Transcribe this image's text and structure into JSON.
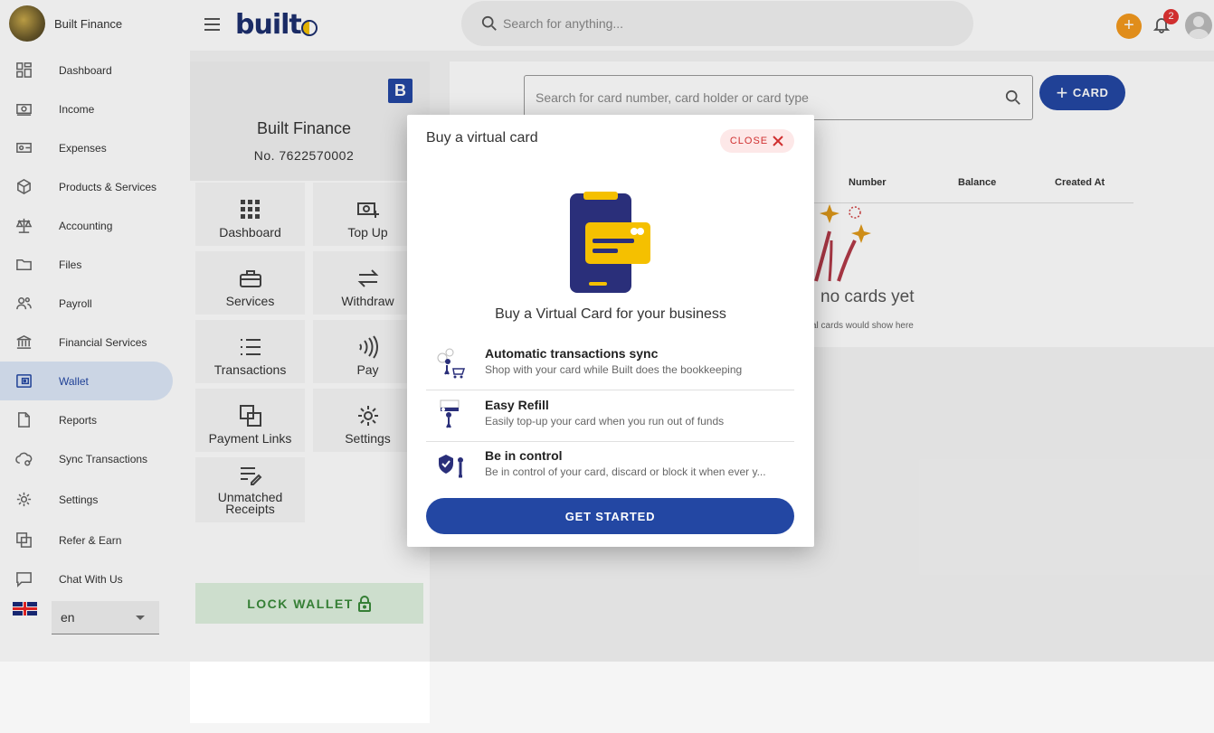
{
  "brand": {
    "name": "Built Finance"
  },
  "topbar": {
    "logo_text": "built",
    "search_placeholder": "Search for anything...",
    "add_label": "+",
    "notification_count": "2"
  },
  "sidebar": {
    "items": [
      {
        "label": "Dashboard",
        "icon": "dashboard-icon"
      },
      {
        "label": "Income",
        "icon": "income-icon"
      },
      {
        "label": "Expenses",
        "icon": "expenses-icon"
      },
      {
        "label": "Products & Services",
        "icon": "box-icon"
      },
      {
        "label": "Accounting",
        "icon": "scale-icon"
      },
      {
        "label": "Files",
        "icon": "folder-icon"
      },
      {
        "label": "Payroll",
        "icon": "people-icon"
      },
      {
        "label": "Financial Services",
        "icon": "bank-icon"
      },
      {
        "label": "Wallet",
        "icon": "wallet-icon",
        "active": true
      },
      {
        "label": "Reports",
        "icon": "document-icon"
      },
      {
        "label": "Sync Transactions",
        "icon": "cloud-sync-icon"
      },
      {
        "label": "Settings",
        "icon": "gear-icon"
      },
      {
        "label": "Refer & Earn",
        "icon": "refer-icon"
      },
      {
        "label": "Chat With Us",
        "icon": "chat-icon"
      }
    ],
    "language": "en"
  },
  "wallet": {
    "badge": "B",
    "name": "Built Finance",
    "number": "No. 7622570002",
    "tiles": [
      {
        "label": "Dashboard"
      },
      {
        "label": "Top Up"
      },
      {
        "label": "Services"
      },
      {
        "label": "Withdraw"
      },
      {
        "label": "Transactions"
      },
      {
        "label": "Pay"
      },
      {
        "label": "Payment Links"
      },
      {
        "label": "Settings"
      },
      {
        "label": "Unmatched Receipts"
      }
    ],
    "lock_label": "LOCK WALLET"
  },
  "cards": {
    "search_placeholder": "Search for card number, card holder or card type",
    "add_label": "CARD",
    "columns": [
      "Number",
      "Balance",
      "Created At"
    ],
    "empty_title": "no cards yet",
    "empty_sub": "al cards would show here"
  },
  "modal": {
    "title": "Buy a virtual card",
    "close_label": "CLOSE",
    "subtitle": "Buy a Virtual Card for your business",
    "features": [
      {
        "title": "Automatic transactions sync",
        "desc": "Shop with your card while Built does the bookkeeping"
      },
      {
        "title": "Easy Refill",
        "desc": "Easily top-up your card when you run out of funds"
      },
      {
        "title": "Be in control",
        "desc": "Be in control of your card, discard or block it when ever y..."
      }
    ],
    "cta": "GET STARTED"
  },
  "colors": {
    "primary": "#2347a3",
    "accent": "#f5c000",
    "danger": "#d03030",
    "success": "#3a8a3a"
  }
}
